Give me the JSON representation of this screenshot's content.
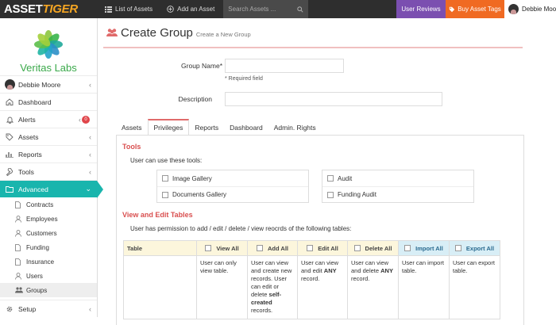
{
  "topbar": {
    "logo_part1": "ASSET",
    "logo_part2": "TIGER",
    "nav": [
      {
        "label": "List of Assets",
        "icon": "list-icon"
      },
      {
        "label": "Add an Asset",
        "icon": "plus-circle-icon"
      }
    ],
    "search_placeholder": "Search Assets ...",
    "user_reviews": "User Reviews",
    "buy_tags": "Buy Asset Tags",
    "user_name": "Debbie Moore",
    "colors": {
      "bar": "#2e2e2e",
      "reviews": "#7b4fb0",
      "buy": "#f06a22"
    }
  },
  "sidebar": {
    "brand": "Veritas Labs",
    "user": "Debbie Moore",
    "items": [
      {
        "label": "Dashboard",
        "icon": "home-icon"
      },
      {
        "label": "Alerts",
        "icon": "bell-icon",
        "badge": "0"
      },
      {
        "label": "Assets",
        "icon": "tag-icon"
      },
      {
        "label": "Reports",
        "icon": "chart-icon"
      },
      {
        "label": "Tools",
        "icon": "wrench-icon"
      },
      {
        "label": "Advanced",
        "icon": "folder-icon"
      }
    ],
    "subitems": [
      {
        "label": "Contracts",
        "icon": "document-icon"
      },
      {
        "label": "Employees",
        "icon": "person-icon"
      },
      {
        "label": "Customers",
        "icon": "person-icon"
      },
      {
        "label": "Funding",
        "icon": "document-icon"
      },
      {
        "label": "Insurance",
        "icon": "document-icon"
      },
      {
        "label": "Users",
        "icon": "person-icon"
      },
      {
        "label": "Groups",
        "icon": "group-icon"
      }
    ],
    "setup": "Setup",
    "accent": "#19b5ad"
  },
  "page": {
    "title": "Create Group",
    "subtitle": "Create a New Group",
    "group_name_label": "Group Name*",
    "group_name_value": "",
    "required_note": "* Required field",
    "description_label": "Description",
    "description_value": ""
  },
  "tabs": [
    "Assets",
    "Privileges",
    "Reports",
    "Dashboard",
    "Admin. Rights"
  ],
  "tools": {
    "title": "Tools",
    "intro": "User can use these tools:",
    "left": [
      "Image Gallery",
      "Documents Gallery"
    ],
    "right": [
      "Audit",
      "Funding Audit"
    ]
  },
  "tables": {
    "title": "View and Edit Tables",
    "intro": "User has permission to add / edit / delete / view reocrds of the following tables:",
    "headers": [
      "Table",
      "View All",
      "Add All",
      "Edit All",
      "Delete All",
      "Import All",
      "Export All"
    ],
    "descriptions": {
      "view": "User can only view table.",
      "add_a": "User can view and create new records. User can edit or delete ",
      "add_b": "self-created",
      "add_c": " records.",
      "edit_a": "User can view and edit ",
      "edit_b": "ANY",
      "edit_c": " record.",
      "delete_a": "User can view and delete ",
      "delete_b": "ANY",
      "delete_c": " record.",
      "import": "User can import table.",
      "export": "User can export table."
    }
  }
}
